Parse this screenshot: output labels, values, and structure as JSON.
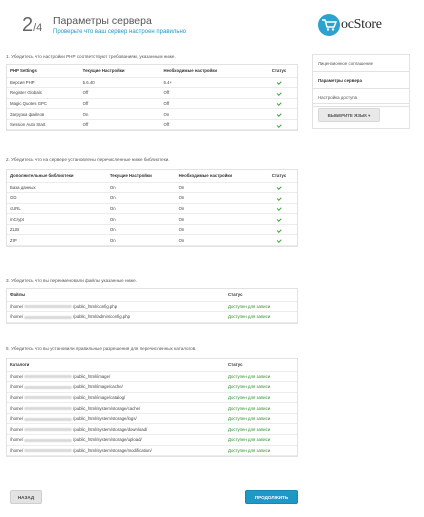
{
  "header": {
    "step_current": "2",
    "step_total": "/4",
    "title": "Параметры сервера",
    "subtitle": "Проверьте что ваш сервер настроен правильно",
    "logo_text": "ocStore"
  },
  "section1": {
    "label": "1. Убедитесь что настройки PHP соответствуют требованиям, указанным ниже.",
    "headers": [
      "PHP Settings",
      "Текущие Настройки",
      "Необходимые настройки",
      "Статус"
    ],
    "rows": [
      [
        "Версия PHP",
        "5.6.40",
        "5.4+"
      ],
      [
        "Register Globals",
        "Off",
        "Off"
      ],
      [
        "Magic Quotes GPC",
        "Off",
        "Off"
      ],
      [
        "Загрузка файлов",
        "On",
        "On"
      ],
      [
        "Session Auto Start",
        "Off",
        "Off"
      ]
    ]
  },
  "section2": {
    "label": "2. Убедитесь что на сервере установлены перечисленные ниже библиотеки.",
    "headers": [
      "Дополнительные библиотеки",
      "Текущие Настройки",
      "Необходимые настройки",
      "Статус"
    ],
    "rows": [
      [
        "База данных",
        "On",
        "On"
      ],
      [
        "GD",
        "On",
        "On"
      ],
      [
        "cURL",
        "On",
        "On"
      ],
      [
        "mCrypt",
        "On",
        "On"
      ],
      [
        "ZLIB",
        "On",
        "On"
      ],
      [
        "ZIP",
        "On",
        "On"
      ]
    ]
  },
  "section3": {
    "label": "3. Убедитесь что вы переименовали файлы указанные ниже.",
    "headers": [
      "Файлы",
      "Статус"
    ],
    "rows": [
      [
        "/home/",
        "/public_html/config.php",
        "Доступен для записи"
      ],
      [
        "/home/",
        "/public_html/admin/config.php",
        "Доступен для записи"
      ]
    ]
  },
  "section4": {
    "label": "5. Убедитесь что вы установили правильные разрешения для перечисленных каталогов.",
    "headers": [
      "Каталоги",
      "Статус"
    ],
    "rows": [
      [
        "/home/",
        "/public_html/image/",
        "Доступен для записи"
      ],
      [
        "/home/",
        "/public_html/image/cache/",
        "Доступен для записи"
      ],
      [
        "/home/",
        "/public_html/image/catalog/",
        "Доступен для записи"
      ],
      [
        "/home/",
        "/public_html/system/storage/cache/",
        "Доступен для записи"
      ],
      [
        "/home/",
        "/public_html/system/storage/logs/",
        "Доступен для записи"
      ],
      [
        "/home/",
        "/public_html/system/storage/download/",
        "Доступен для записи"
      ],
      [
        "/home/",
        "/public_html/system/storage/upload/",
        "Доступен для записи"
      ],
      [
        "/home/",
        "/public_html/system/storage/modification/",
        "Доступен для записи"
      ]
    ]
  },
  "sidebar": {
    "items": [
      "Лицензионное соглашение",
      "Параметры сервера",
      "Настройка доступа"
    ],
    "active_index": 1,
    "language_button": "ВЫБЕРИТЕ ЯЗЫК ▾"
  },
  "footer": {
    "back_label": "НАЗАД",
    "next_label": "ПРОДОЛЖИТЬ"
  },
  "colors": {
    "accent": "#1e98c7",
    "ok_green": "#3aa33a"
  }
}
